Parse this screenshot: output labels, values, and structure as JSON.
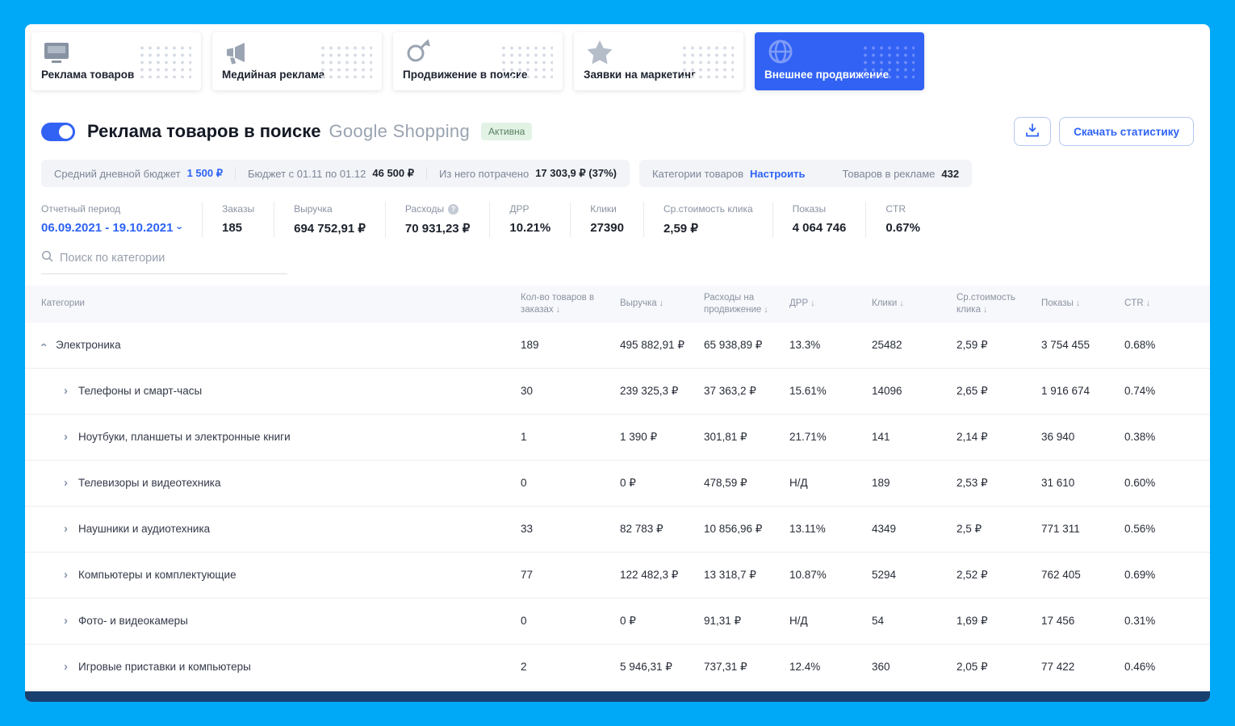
{
  "icons": {
    "sort_desc": "↓",
    "help": "?",
    "chevron": "›"
  },
  "nav_tabs": [
    {
      "label": "Реклама товаров",
      "icon": "tv-icon",
      "active": false
    },
    {
      "label": "Медийная реклама",
      "icon": "megaphone-icon",
      "active": false
    },
    {
      "label": "Продвижение в поиске",
      "icon": "search-up-icon",
      "active": false
    },
    {
      "label": "Заявки на маркетинг",
      "icon": "star-icon",
      "active": false
    },
    {
      "label": "Внешнее продвижение",
      "icon": "globe-icon",
      "active": true
    }
  ],
  "header": {
    "toggle_on": true,
    "title": "Реклама товаров в поиске",
    "subtitle": "Google Shopping",
    "status_badge": "Активна",
    "download_button": "Скачать статистику"
  },
  "budget_bar": {
    "items": [
      {
        "label": "Средний дневной бюджет",
        "value": "1 500 ₽"
      },
      {
        "label": "Бюджет с 01.11 по 01.12",
        "value": "46 500 ₽"
      },
      {
        "label": "Из него потрачено",
        "value": "17 303,9 ₽ (37%)"
      }
    ],
    "right_items": [
      {
        "label": "Категории товаров",
        "value": "Настроить"
      },
      {
        "label": "Товаров в рекламе",
        "value": "432"
      }
    ]
  },
  "stats": [
    {
      "label": "Отчетный период",
      "value": "06.09.2021 - 19.10.2021"
    },
    {
      "label": "Заказы",
      "value": "185"
    },
    {
      "label": "Выручка",
      "value": "694 752,91 ₽"
    },
    {
      "label": "Расходы",
      "value": "70 931,23 ₽"
    },
    {
      "label": "ДРР",
      "value": "10.21%"
    },
    {
      "label": "Клики",
      "value": "27390"
    },
    {
      "label": "Ср.стоимость клика",
      "value": "2,59 ₽"
    },
    {
      "label": "Показы",
      "value": "4 064 746"
    },
    {
      "label": "CTR",
      "value": "0.67%"
    }
  ],
  "search": {
    "placeholder": "Поиск по категории"
  },
  "table": {
    "columns": [
      "Категории",
      "Кол-во товаров в заказах",
      "Выручка",
      "Расходы на продвижение",
      "ДРР",
      "Клики",
      "Ср.стоимость клика",
      "Показы",
      "CTR"
    ],
    "rows": [
      {
        "name": "Электроника",
        "level": 0,
        "expanded": true,
        "values": [
          "189",
          "495 882,91 ₽",
          "65 938,89 ₽",
          "13.3%",
          "25482",
          "2,59 ₽",
          "3 754 455",
          "0.68%"
        ]
      },
      {
        "name": "Телефоны и смарт-часы",
        "level": 1,
        "expanded": false,
        "values": [
          "30",
          "239 325,3 ₽",
          "37 363,2 ₽",
          "15.61%",
          "14096",
          "2,65 ₽",
          "1 916 674",
          "0.74%"
        ]
      },
      {
        "name": "Ноутбуки, планшеты и электронные книги",
        "level": 1,
        "expanded": false,
        "values": [
          "1",
          "1 390 ₽",
          "301,81 ₽",
          "21.71%",
          "141",
          "2,14 ₽",
          "36 940",
          "0.38%"
        ]
      },
      {
        "name": "Телевизоры и видеотехника",
        "level": 1,
        "expanded": false,
        "values": [
          "0",
          "0 ₽",
          "478,59 ₽",
          "Н/Д",
          "189",
          "2,53 ₽",
          "31 610",
          "0.60%"
        ]
      },
      {
        "name": "Наушники и аудиотехника",
        "level": 1,
        "expanded": false,
        "values": [
          "33",
          "82 783 ₽",
          "10 856,96 ₽",
          "13.11%",
          "4349",
          "2,5 ₽",
          "771 311",
          "0.56%"
        ]
      },
      {
        "name": "Компьютеры и комплектующие",
        "level": 1,
        "expanded": false,
        "values": [
          "77",
          "122 482,3 ₽",
          "13 318,7 ₽",
          "10.87%",
          "5294",
          "2,52 ₽",
          "762 405",
          "0.69%"
        ]
      },
      {
        "name": "Фото- и видеокамеры",
        "level": 1,
        "expanded": false,
        "values": [
          "0",
          "0 ₽",
          "91,31 ₽",
          "Н/Д",
          "54",
          "1,69 ₽",
          "17 456",
          "0.31%"
        ]
      },
      {
        "name": "Игровые приставки и компьютеры",
        "level": 1,
        "expanded": false,
        "values": [
          "2",
          "5 946,31 ₽",
          "737,31 ₽",
          "12.4%",
          "360",
          "2,05 ₽",
          "77 422",
          "0.46%"
        ]
      }
    ]
  }
}
